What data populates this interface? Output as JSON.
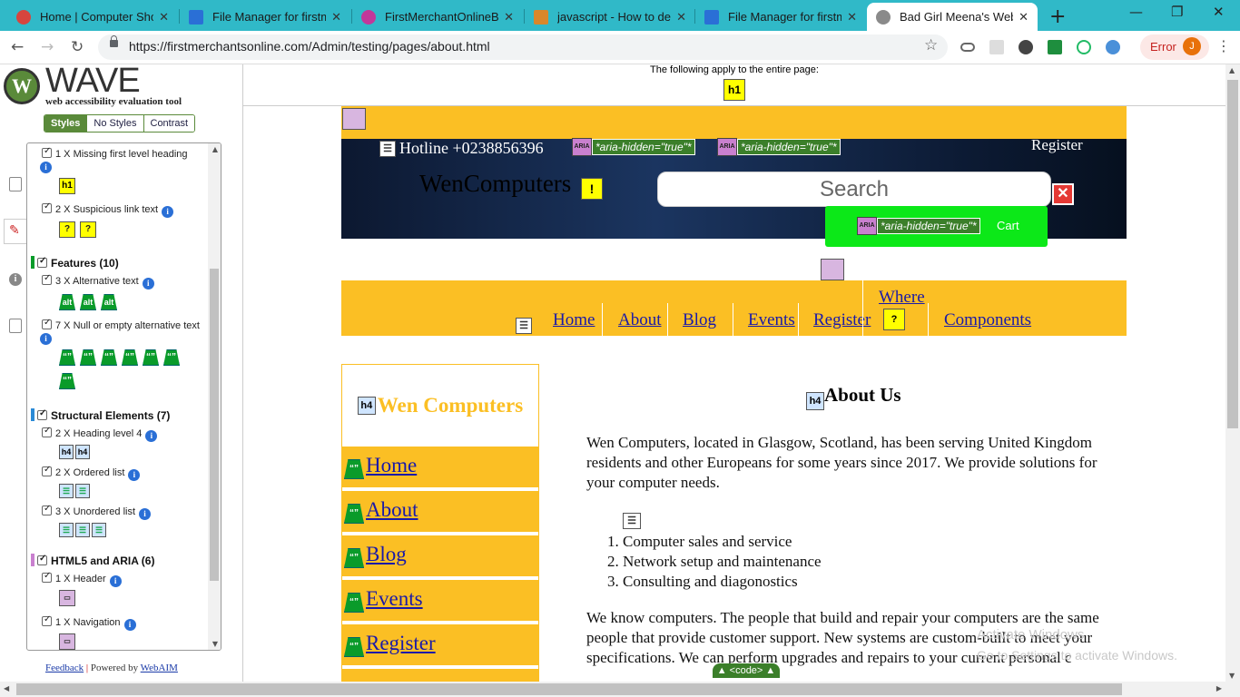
{
  "browser": {
    "tabs": [
      {
        "title": "Home | Computer Shop",
        "favicon_color": "#d6453e"
      },
      {
        "title": "File Manager for firstmerchantsonline",
        "favicon_color": "#2a6fd6"
      },
      {
        "title": "FirstMerchantOnlineBank",
        "favicon_color": "#c2389a"
      },
      {
        "title": "javascript - How to delete",
        "favicon_color": "#d9872a"
      },
      {
        "title": "File Manager for firstmerchantsonline",
        "favicon_color": "#2a6fd6"
      },
      {
        "title": "Bad Girl Meena's Website",
        "favicon_color": "#8a8a8a"
      }
    ],
    "active_tab_index": 5,
    "new_tab": "+",
    "url": "https://firstmerchantsonline.com/Admin/testing/pages/about.html",
    "error_label": "Error",
    "profile_initial": "J",
    "window_controls": {
      "minimize": "—",
      "maximize": "❐",
      "close": "✕"
    },
    "nav": {
      "back": "←",
      "forward": "→",
      "reload": "↻"
    }
  },
  "wave": {
    "logo_title": "WAVE",
    "logo_subtitle": "web accessibility evaluation tool",
    "view_tabs": [
      "Styles",
      "No Styles",
      "Contrast"
    ],
    "active_view": "Styles",
    "items": [
      {
        "label": "1 X Missing first level heading",
        "icons": [
          "h1"
        ]
      },
      {
        "label": "2 X Suspicious link text",
        "icons": [
          "?",
          "?"
        ]
      },
      {
        "label": "3 X Alternative text",
        "icons": [
          "alt",
          "alt",
          "alt"
        ]
      },
      {
        "label": "7 X Null or empty alternative text",
        "icons": [
          "“”",
          "“”",
          "“”",
          "“”",
          "“”",
          "“”",
          "“”"
        ]
      },
      {
        "label": "2 X Heading level 4",
        "icons": [
          "h4",
          "h4"
        ]
      },
      {
        "label": "2 X Ordered list",
        "icons": [
          "☰",
          "☰"
        ]
      },
      {
        "label": "3 X Unordered list",
        "icons": [
          "☰",
          "☰",
          "☰"
        ]
      },
      {
        "label": "1 X Header",
        "icons": [
          "▭"
        ]
      },
      {
        "label": "1 X Navigation",
        "icons": [
          "▭"
        ]
      }
    ],
    "categories": [
      {
        "label": "Features (10)",
        "color": "#0a9b2a"
      },
      {
        "label": "Structural Elements (7)",
        "color": "#2a8ad6"
      },
      {
        "label": "HTML5 and ARIA (6)",
        "color": "#c980cf"
      }
    ],
    "footer_feedback": "Feedback",
    "footer_sep": "|",
    "footer_powered": "Powered by",
    "footer_webaim": "WebAIM",
    "collapse_glyph": "<"
  },
  "page": {
    "note": "The following apply to the entire page:",
    "page_icon": "h1",
    "hotline": "Hotline +0238856396",
    "aria_label": "ARIA",
    "aria_hidden": "*aria-hidden=\"true\"*",
    "register_top": "Register",
    "brand": "WenComputers",
    "search_placeholder": "Search",
    "cart": "Cart",
    "nav_links": [
      "Home",
      "About",
      "Blog",
      "Events",
      "Register",
      "Components"
    ],
    "nav_where": "Where",
    "side_title": "Wen Computers",
    "side_links": [
      "Home",
      "About",
      "Blog",
      "Events",
      "Register"
    ],
    "about_heading": "About Us",
    "h4_icon": "h4",
    "para1": "Wen Computers, located in Glasgow, Scotland, has been serving United Kingdom residents and other Europeans for some years since 2017. We provide solutions for your computer needs.",
    "services": [
      "Computer sales and service",
      "Network setup and maintenance",
      "Consulting and diagonostics"
    ],
    "para2": "We know computers. The people that build and repair your computers are the same people that provide customer support. New systems are custom-built to meet your specifications. We can perform upgrades and repairs to your current personal c",
    "code_tab": "▲ <code> ▲",
    "watermark": "Activate Windows",
    "watermark_sub": "Go to Settings to activate Windows."
  }
}
